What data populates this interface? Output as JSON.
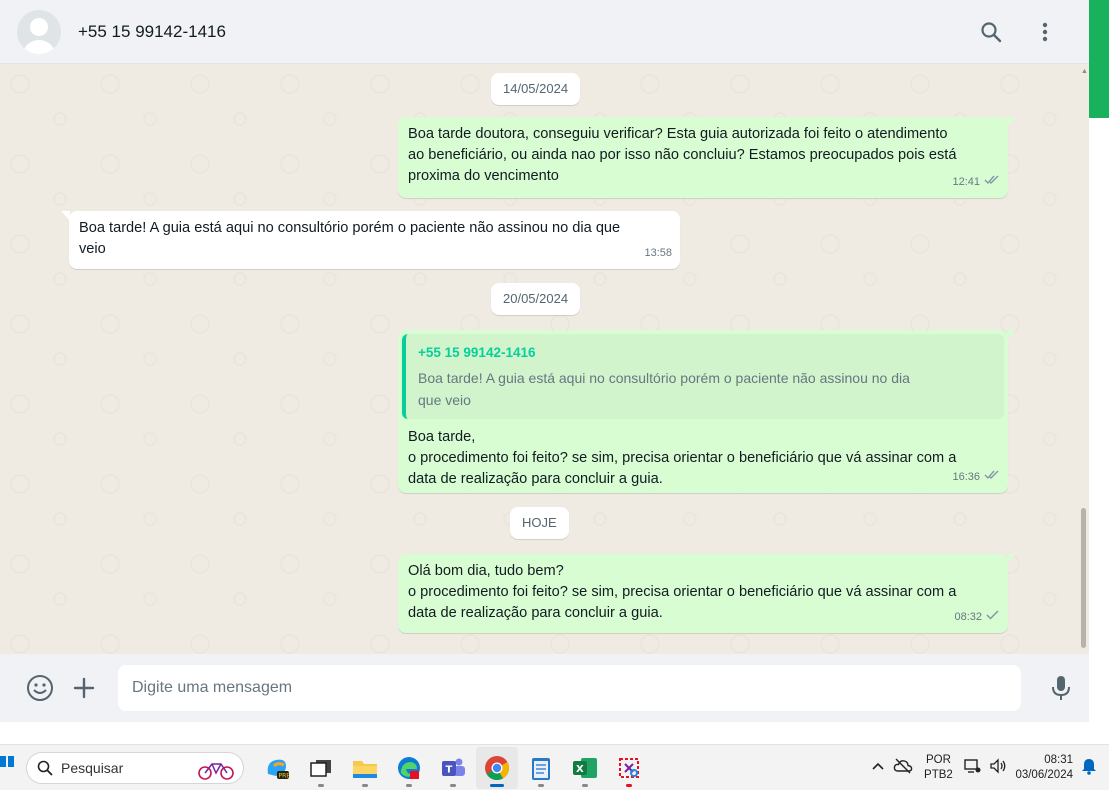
{
  "header": {
    "contact_name": "+55 15 99142-1416"
  },
  "chat": {
    "date_1": "14/05/2024",
    "msg_1": {
      "text": "Boa tarde doutora, conseguiu verificar? Esta guia autorizada foi feito o atendimento\nao beneficiário, ou ainda nao por isso não concluiu? Estamos preocupados pois está\nproxima do vencimento",
      "time": "12:41",
      "status": "read"
    },
    "msg_2": {
      "text": "Boa tarde! A guia está aqui no consultório porém o paciente não assinou no dia que\nveio",
      "time": "13:58"
    },
    "date_2": "20/05/2024",
    "msg_3": {
      "quote_author": "+55 15 99142-1416",
      "quote_text": "Boa tarde! A guia está aqui no consultório porém o paciente não assinou no dia\nque veio",
      "text": "Boa tarde,\no procedimento foi feito? se sim, precisa orientar o beneficiário que vá assinar com a\ndata de realização para concluir a guia.",
      "time": "16:36",
      "status": "read"
    },
    "date_3": "HOJE",
    "msg_4": {
      "text": "Olá bom dia, tudo bem?\no procedimento foi feito? se sim, precisa orientar o beneficiário que vá assinar com a\ndata de realização para concluir a guia.",
      "time": "08:32",
      "status": "sent"
    }
  },
  "composer": {
    "placeholder": "Digite uma mensagem"
  },
  "taskbar": {
    "search_label": "Pesquisar",
    "lang_line1": "POR",
    "lang_line2": "PTB2",
    "time": "08:31",
    "date": "03/06/2024"
  },
  "colors": {
    "accent": "#00a884",
    "outgoing_bubble": "#d9fdd3",
    "incoming_bubble": "#ffffff",
    "quote_bar": "#06cf9c",
    "scroll_accent": "#19b15c"
  }
}
